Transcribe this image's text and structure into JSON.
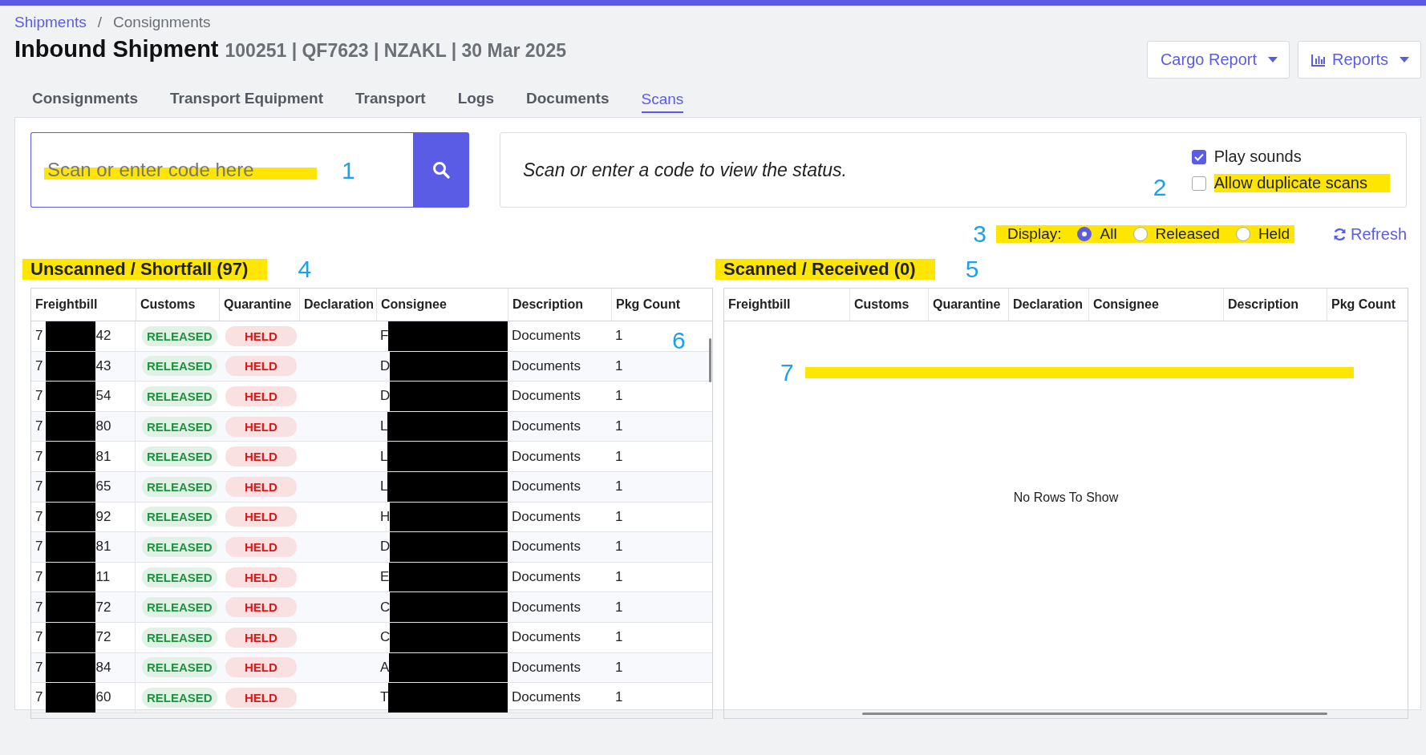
{
  "breadcrumb": {
    "items": [
      {
        "label": "Shipments",
        "link": true
      },
      {
        "label": "Consignments",
        "link": false
      }
    ],
    "separator": "/"
  },
  "title": "Inbound Shipment",
  "subtitle": "100251 | QF7623 | NZAKL | 30 Mar 2025",
  "header_buttons": [
    {
      "label": "Cargo Report",
      "icon": false
    },
    {
      "label": "Reports",
      "icon": true
    }
  ],
  "tabs": [
    {
      "label": "Consignments",
      "selected": false
    },
    {
      "label": "Transport Equipment",
      "selected": false
    },
    {
      "label": "Transport",
      "selected": false
    },
    {
      "label": "Logs",
      "selected": false
    },
    {
      "label": "Documents",
      "selected": false
    },
    {
      "label": "Scans",
      "selected": true
    }
  ],
  "search": {
    "placeholder": "Scan or enter code here",
    "highlighted": true,
    "callout": "1"
  },
  "status_message": "Scan or enter a code to view the status.",
  "options": [
    {
      "label": "Play sounds",
      "checked": true,
      "highlighted": false
    },
    {
      "label": "Allow duplicate scans",
      "checked": false,
      "highlighted": true,
      "callout": "2"
    }
  ],
  "display": {
    "label": "Display:",
    "highlighted": true,
    "callout": "3",
    "options": [
      {
        "label": "All",
        "selected": true
      },
      {
        "label": "Released",
        "selected": false
      },
      {
        "label": "Held",
        "selected": false
      }
    ]
  },
  "refresh": "Refresh",
  "tables": [
    {
      "title": "Unscanned / Shortfall (97)",
      "highlighted": true,
      "callout": "4",
      "overlay_callout": "6",
      "columns": [
        "Freightbill",
        "Customs",
        "Quarantine",
        "Declaration",
        "Consignee",
        "Description",
        "Pkg Count"
      ],
      "rows": [
        {
          "freightbill_start": "7",
          "freightbill_end": "42",
          "redacted": true,
          "customs": {
            "label": "RELEASED",
            "color": "#1e9440"
          },
          "quarantine": {
            "label": "HELD",
            "color": "#d71a1a"
          },
          "consignee": "F",
          "description": "Documents",
          "pkg_count": "1"
        },
        {
          "freightbill_start": "7",
          "freightbill_end": "43",
          "redacted": true,
          "customs": {
            "label": "RELEASED",
            "color": "#1e9440"
          },
          "quarantine": {
            "label": "HELD",
            "color": "#d71a1a"
          },
          "consignee": "D",
          "description": "Documents",
          "pkg_count": "1"
        },
        {
          "freightbill_start": "7",
          "freightbill_end": "54",
          "redacted": true,
          "customs": {
            "label": "RELEASED",
            "color": "#1e9440"
          },
          "quarantine": {
            "label": "HELD",
            "color": "#d71a1a"
          },
          "consignee": "D",
          "description": "Documents",
          "pkg_count": "1"
        },
        {
          "freightbill_start": "7",
          "freightbill_end": "80",
          "redacted": true,
          "customs": {
            "label": "RELEASED",
            "color": "#1e9440"
          },
          "quarantine": {
            "label": "HELD",
            "color": "#d71a1a"
          },
          "consignee": "L",
          "description": "Documents",
          "pkg_count": "1"
        },
        {
          "freightbill_start": "7",
          "freightbill_end": "81",
          "redacted": true,
          "customs": {
            "label": "RELEASED",
            "color": "#1e9440"
          },
          "quarantine": {
            "label": "HELD",
            "color": "#d71a1a"
          },
          "consignee": "L",
          "description": "Documents",
          "pkg_count": "1"
        },
        {
          "freightbill_start": "7",
          "freightbill_end": "65",
          "redacted": true,
          "customs": {
            "label": "RELEASED",
            "color": "#1e9440"
          },
          "quarantine": {
            "label": "HELD",
            "color": "#d71a1a"
          },
          "consignee": "L",
          "description": "Documents",
          "pkg_count": "1"
        },
        {
          "freightbill_start": "7",
          "freightbill_end": "92",
          "redacted": true,
          "customs": {
            "label": "RELEASED",
            "color": "#1e9440"
          },
          "quarantine": {
            "label": "HELD",
            "color": "#d71a1a"
          },
          "consignee": "H",
          "description": "Documents",
          "pkg_count": "1"
        },
        {
          "freightbill_start": "7",
          "freightbill_end": "81",
          "redacted": true,
          "customs": {
            "label": "RELEASED",
            "color": "#1e9440"
          },
          "quarantine": {
            "label": "HELD",
            "color": "#d71a1a"
          },
          "consignee": "D",
          "description": "Documents",
          "pkg_count": "1"
        },
        {
          "freightbill_start": "7",
          "freightbill_end": "11",
          "redacted": true,
          "customs": {
            "label": "RELEASED",
            "color": "#1e9440"
          },
          "quarantine": {
            "label": "HELD",
            "color": "#d71a1a"
          },
          "consignee": "E",
          "description": "Documents",
          "pkg_count": "1"
        },
        {
          "freightbill_start": "7",
          "freightbill_end": "72",
          "redacted": true,
          "customs": {
            "label": "RELEASED",
            "color": "#1e9440"
          },
          "quarantine": {
            "label": "HELD",
            "color": "#d71a1a"
          },
          "consignee": "C",
          "description": "Documents",
          "pkg_count": "1"
        },
        {
          "freightbill_start": "7",
          "freightbill_end": "72",
          "redacted": true,
          "customs": {
            "label": "RELEASED",
            "color": "#1e9440"
          },
          "quarantine": {
            "label": "HELD",
            "color": "#d71a1a"
          },
          "consignee": "C",
          "description": "Documents",
          "pkg_count": "1"
        },
        {
          "freightbill_start": "7",
          "freightbill_end": "84",
          "redacted": true,
          "customs": {
            "label": "RELEASED",
            "color": "#1e9440"
          },
          "quarantine": {
            "label": "HELD",
            "color": "#d71a1a"
          },
          "consignee": "A",
          "description": "Documents",
          "pkg_count": "1"
        },
        {
          "freightbill_start": "7",
          "freightbill_end": "60",
          "redacted": true,
          "customs": {
            "label": "RELEASED",
            "color": "#1e9440"
          },
          "quarantine": {
            "label": "HELD",
            "color": "#d71a1a"
          },
          "consignee": "T",
          "description": "Documents",
          "pkg_count": "1"
        }
      ]
    },
    {
      "title": "Scanned / Received (0)",
      "highlighted": true,
      "callout": "5",
      "overlay_callout": "7",
      "highlight_bar": true,
      "columns": [
        "Freightbill",
        "Customs",
        "Quarantine",
        "Declaration",
        "Consignee",
        "Description",
        "Pkg Count"
      ],
      "empty_text": "No Rows To Show"
    }
  ]
}
